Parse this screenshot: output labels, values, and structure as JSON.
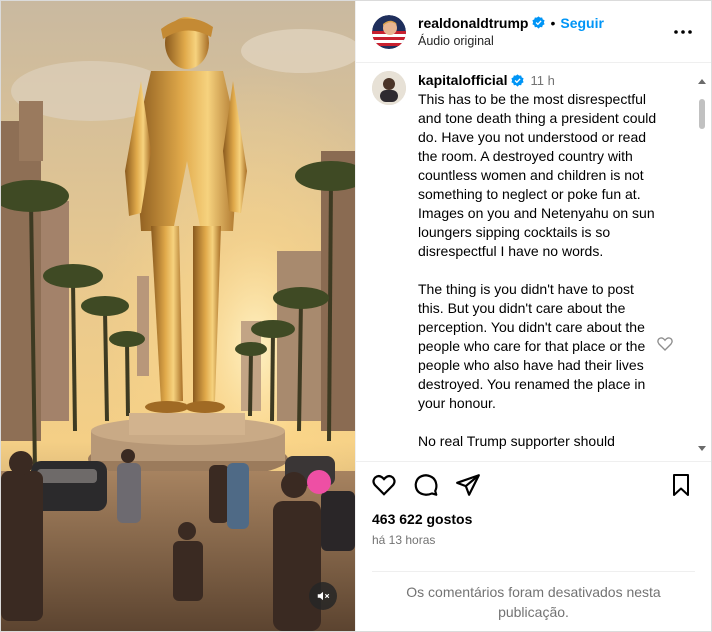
{
  "header": {
    "username": "realdonaldtrump",
    "follow_label": "Seguir",
    "audio_label": "Áudio original",
    "separator": "•"
  },
  "comment": {
    "username": "kapitalofficial",
    "time": "11 h",
    "paragraphs": [
      "This has to be the most disrespectful and tone death thing a president could do. Have you not understood or read the room. A destroyed country with countless women and children is not something to neglect or poke fun at. Images on you and Netenyahu on sun loungers sipping cocktails is so disrespectful I have no words.",
      "The thing is you didn't have to post this. But you didn't care about the perception. You didn't care about the people who care for that place or the people who also have had their lives destroyed. You renamed the place in your honour.",
      "No real Trump supporter should"
    ]
  },
  "stats": {
    "likes": "463 622 gostos",
    "posted_ago": "há 13 horas"
  },
  "comments_disabled": "Os comentários foram desativados nesta publicação.",
  "icons": {
    "verified": "verified-badge-icon",
    "more": "more-options-icon",
    "like": "heart-icon",
    "comment": "comment-icon",
    "share": "share-icon",
    "save": "bookmark-icon",
    "mute": "muted-speaker-icon"
  },
  "colors": {
    "follow_blue": "#0095f6",
    "verified_blue": "#0095f6",
    "muted_text": "#737373"
  }
}
